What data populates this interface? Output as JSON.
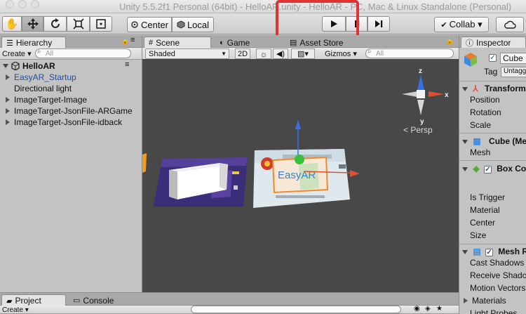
{
  "window": {
    "title": "Unity 5.5.2f1 Personal (64bit) - HelloAR.unity - HelloAR - PC, Mac & Linux Standalone (Personal)"
  },
  "toolbar": {
    "tools": [
      {
        "name": "hand-tool",
        "icon": "hand-icon",
        "glyph": "✋"
      },
      {
        "name": "move-tool",
        "icon": "move-arrows-icon",
        "glyph": "✥"
      },
      {
        "name": "rotate-tool",
        "icon": "rotate-icon",
        "glyph": "⟳"
      },
      {
        "name": "scale-tool",
        "icon": "scale-icon",
        "glyph": "⤡"
      },
      {
        "name": "rect-tool",
        "icon": "rect-icon",
        "glyph": "▣"
      }
    ],
    "pivot_label": "Center",
    "space_label": "Local",
    "collab_label": "Collab ▾"
  },
  "hierarchy": {
    "tab_label": "Hierarchy",
    "create_label": "Create ▾",
    "search_placeholder": "All",
    "scene_name": "HelloAR",
    "items": [
      {
        "label": "EasyAR_Startup",
        "expandable": true,
        "highlight": true
      },
      {
        "label": "Directional light",
        "expandable": false,
        "highlight": false
      },
      {
        "label": "ImageTarget-Image",
        "expandable": true,
        "highlight": false
      },
      {
        "label": "ImageTarget-JsonFile-ARGame",
        "expandable": true,
        "highlight": false
      },
      {
        "label": "ImageTarget-JsonFile-idback",
        "expandable": true,
        "highlight": false
      }
    ]
  },
  "scene": {
    "tabs": {
      "scene": "Scene",
      "game": "Game",
      "asset_store": "Asset Store"
    },
    "shading_mode": "Shaded",
    "mode_2d": "2D",
    "gizmos_label": "Gizmos ▾",
    "search_placeholder": "All",
    "persp_label": "Persp",
    "axis_labels": {
      "x": "x",
      "y": "y",
      "z": "z"
    },
    "card_text": "EasyAR"
  },
  "inspector": {
    "tab_label": "Inspector",
    "object_name": "Cube",
    "tag_label": "Tag",
    "tag_value": "Untagged",
    "transform": {
      "header": "Transform",
      "rows": [
        "Position",
        "Rotation",
        "Scale"
      ]
    },
    "mesh_filter": {
      "header": "Cube (Mesh Filter)",
      "rows": [
        "Mesh"
      ]
    },
    "box_collider": {
      "header": "Box Collider",
      "rows": [
        "Is Trigger",
        "Material",
        "Center",
        "Size"
      ]
    },
    "mesh_renderer": {
      "header": "Mesh Renderer",
      "rows": [
        "Cast Shadows",
        "Receive Shadows",
        "Motion Vectors",
        "Materials",
        "Light Probes"
      ]
    }
  },
  "bottom": {
    "project_tab": "Project",
    "console_tab": "Console",
    "create_label": "Create ▾"
  },
  "colors": {
    "accent_red": "#e03434",
    "selection_blue": "#1c4fa7",
    "scene_bg": "#484848"
  }
}
